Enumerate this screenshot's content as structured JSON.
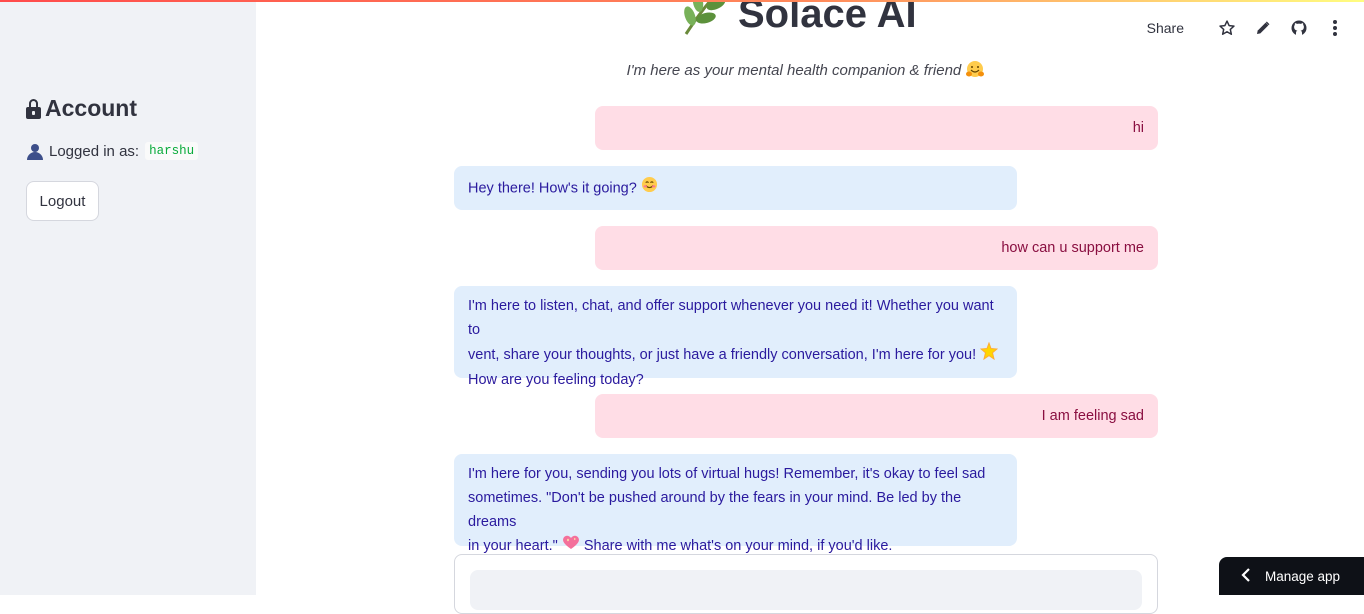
{
  "sidebar": {
    "account_heading": "Account",
    "logged_in_label": "Logged in as:",
    "username": "harshu",
    "logout_label": "Logout"
  },
  "toolbar": {
    "share_label": "Share",
    "icons": [
      "star-icon",
      "pencil-icon",
      "github-icon",
      "more-vert-icon"
    ]
  },
  "header": {
    "title": "Solace AI",
    "title_icon": "herb-icon",
    "subtitle": "I'm here as your mental health companion & friend",
    "subtitle_icon": "hugging-face-emoji"
  },
  "chat": {
    "messages": [
      {
        "role": "user",
        "text": "hi"
      },
      {
        "role": "assistant",
        "text": "Hey there! How's it going?",
        "emoji": "smiling-face-emoji"
      },
      {
        "role": "user",
        "text": "how can u support me"
      },
      {
        "role": "assistant",
        "line1": "I'm here to listen, chat, and offer support whenever you need it! Whether you want to",
        "line2": "vent, share your thoughts, or just have a friendly conversation, I'm here for you!",
        "line3": "How are you feeling today?",
        "emoji": "glowing-star-emoji"
      },
      {
        "role": "user",
        "text": "I am feeling sad"
      },
      {
        "role": "assistant",
        "line1": "I'm here for you, sending you lots of virtual hugs! Remember, it's okay to feel sad",
        "line2": "sometimes. \"Don't be pushed around by the fears in your mind. Be led by the dreams",
        "line3a": "in your heart.\"",
        "line3b": "Share with me what's on your mind, if you'd like.",
        "emoji": "sparkling-heart-emoji"
      }
    ],
    "input_placeholder": ""
  },
  "manage_app": {
    "label": "Manage app"
  },
  "colors": {
    "sidebar_bg": "#f0f2f6",
    "user_bubble": "#ffdde6",
    "user_text": "#8a0f41",
    "bot_bubble": "#e1eefc",
    "bot_text": "#2a1a9e"
  }
}
